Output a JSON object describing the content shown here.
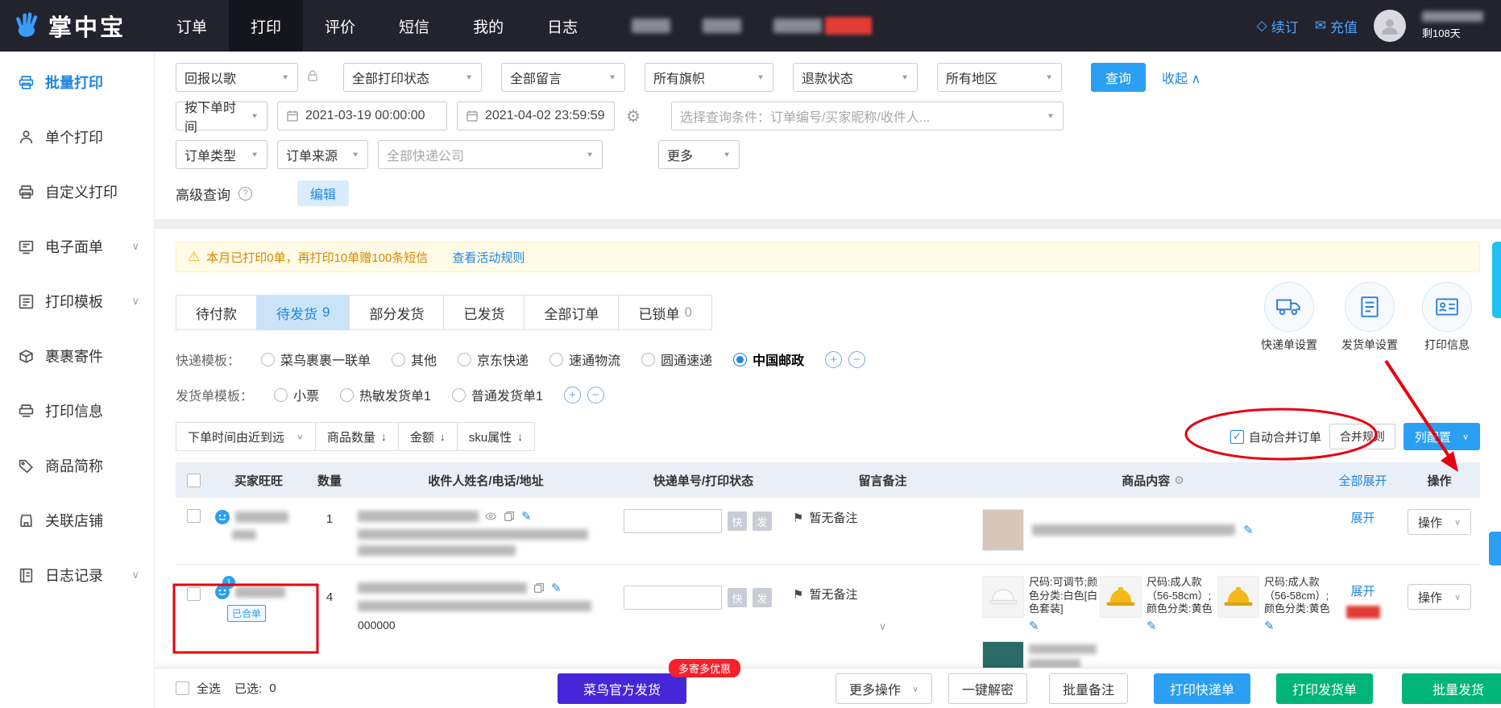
{
  "icons": {
    "caret_down": "▼",
    "chevron_down": "∨",
    "chevron_up": "∧",
    "sort_down": "↓",
    "check": "✓",
    "flag": "⚑",
    "diamond": "◇",
    "mail": "✉",
    "warning": "⚠",
    "question": "?",
    "gear": "⚙",
    "plus": "+",
    "minus": "−",
    "edit": "✎"
  },
  "topnav": {
    "logo_text": "掌中宝",
    "menu": [
      {
        "label": "订单"
      },
      {
        "label": "打印"
      },
      {
        "label": "评价"
      },
      {
        "label": "短信"
      },
      {
        "label": "我的"
      },
      {
        "label": "日志"
      }
    ],
    "renew_label": "续订",
    "recharge_label": "充值",
    "days_left": "剩108天"
  },
  "sidebar": {
    "items": [
      {
        "label": "批量打印"
      },
      {
        "label": "单个打印"
      },
      {
        "label": "自定义打印"
      },
      {
        "label": "电子面单"
      },
      {
        "label": "打印模板"
      },
      {
        "label": "裹裹寄件"
      },
      {
        "label": "打印信息"
      },
      {
        "label": "商品简称"
      },
      {
        "label": "关联店铺"
      },
      {
        "label": "日志记录"
      }
    ]
  },
  "filters": {
    "shop": "回报以歌",
    "print_status": "全部打印状态",
    "message": "全部留言",
    "flag": "所有旗帜",
    "refund": "退款状态",
    "region": "所有地区",
    "search_button": "查询",
    "collapse_link": "收起",
    "time_type": "按下单时间",
    "date_from": "2021-03-19 00:00:00",
    "date_to": "2021-04-02 23:59:59",
    "keyword_placeholder": "选择查询条件：订单编号/买家昵称/收件人...",
    "order_type": "订单类型",
    "order_source": "订单来源",
    "courier": "全部快递公司",
    "more": "更多",
    "advanced_label": "高级查询",
    "edit_button": "编辑"
  },
  "notice": {
    "text": "本月已打印0单，再打印10单赠100条短信",
    "link": "查看活动规则"
  },
  "tabs": [
    {
      "label": "待付款",
      "count": ""
    },
    {
      "label": "待发货",
      "count": "9"
    },
    {
      "label": "部分发货",
      "count": ""
    },
    {
      "label": "已发货",
      "count": ""
    },
    {
      "label": "全部订单",
      "count": ""
    },
    {
      "label": "已锁单",
      "count": "0"
    }
  ],
  "quick_settings": [
    {
      "label": "快递单设置"
    },
    {
      "label": "发货单设置"
    },
    {
      "label": "打印信息"
    }
  ],
  "express_template": {
    "label": "快递模板：",
    "options": [
      {
        "label": "菜鸟裹裹一联单"
      },
      {
        "label": "其他"
      },
      {
        "label": "京东快递"
      },
      {
        "label": "速通物流"
      },
      {
        "label": "圆通速递"
      },
      {
        "label": "中国邮政"
      }
    ]
  },
  "invoice_template": {
    "label": "发货单模板：",
    "options": [
      {
        "label": "小票"
      },
      {
        "label": "热敏发货单1"
      },
      {
        "label": "普通发货单1"
      }
    ]
  },
  "toolbar": {
    "sort_time": "下单时间由近到远",
    "sort_qty": "商品数量",
    "sort_amount": "金额",
    "sort_sku": "sku属性",
    "auto_merge": "自动合并订单",
    "merge_rules": "合并规则",
    "column_config": "列配置"
  },
  "table": {
    "headers": {
      "buyer": "买家旺旺",
      "qty": "数量",
      "receiver": "收件人姓名/电话/地址",
      "waybill": "快递单号/打印状态",
      "remark": "留言备注",
      "product": "商品内容",
      "expand_all": "全部展开",
      "action": "操作"
    },
    "rows": [
      {
        "qty": "1",
        "badge_express": "快",
        "badge_ship": "发",
        "remark": "暂无备注",
        "expand": "展开",
        "action": "操作"
      },
      {
        "buyer_badge": "1",
        "merged_tag": "已合单",
        "qty": "4",
        "postcode": "000000",
        "badge_express": "快",
        "badge_ship": "发",
        "remark": "暂无备注",
        "expand": "展开",
        "action": "操作",
        "products": [
          {
            "text": "尺码:可调节;颜色分类:白色[白色套装]"
          },
          {
            "text": "尺码:成人款（56-58cm）;颜色分类:黄色"
          },
          {
            "text": "尺码:成人款（56-58cm）;颜色分类:黄色"
          }
        ]
      }
    ]
  },
  "bottom_bar": {
    "select_all": "全选",
    "selected_label": "已选:",
    "selected_count": "0",
    "cainiao_ship": "菜鸟官方发货",
    "promo": "多寄多优惠",
    "more_actions": "更多操作",
    "one_key_decrypt": "一键解密",
    "batch_remark": "批量备注",
    "print_express": "打印快递单",
    "print_invoice": "打印发货单",
    "batch_ship": "批量发货"
  }
}
